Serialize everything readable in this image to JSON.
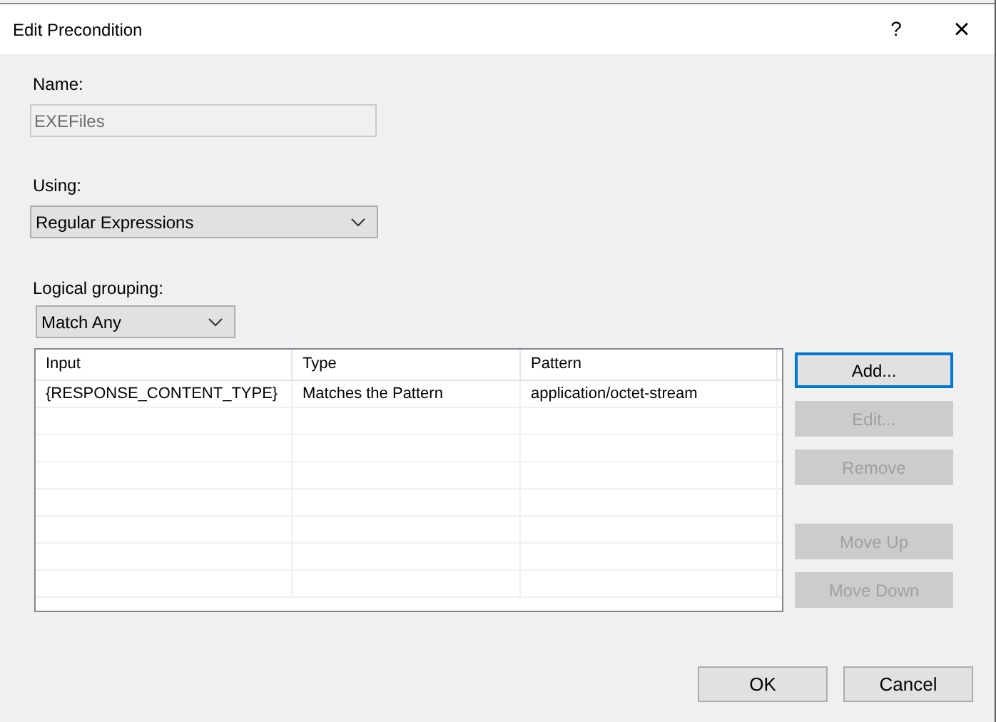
{
  "window": {
    "title": "Edit Precondition",
    "help_button": "?",
    "close_button": "×"
  },
  "name_field": {
    "label": "Name:",
    "value": "EXEFiles",
    "disabled": true
  },
  "using": {
    "label": "Using:",
    "value": "Regular Expressions"
  },
  "logical_grouping": {
    "label": "Logical grouping:",
    "value": "Match Any"
  },
  "table": {
    "columns": [
      "Input",
      "Type",
      "Pattern"
    ],
    "rows": [
      [
        "{RESPONSE_CONTENT_TYPE}",
        "Matches the Pattern",
        "application/octet-stream"
      ]
    ]
  },
  "side_buttons": [
    {
      "label": "Add...",
      "disabled": false,
      "focused": true
    },
    {
      "label": "Edit...",
      "disabled": true,
      "focused": false
    },
    {
      "label": "Remove",
      "disabled": true,
      "focused": false
    },
    {
      "label": "Move Up",
      "disabled": true,
      "focused": false
    },
    {
      "label": "Move Down",
      "disabled": true,
      "focused": false
    }
  ],
  "footer_buttons": [
    "OK",
    "Cancel"
  ]
}
